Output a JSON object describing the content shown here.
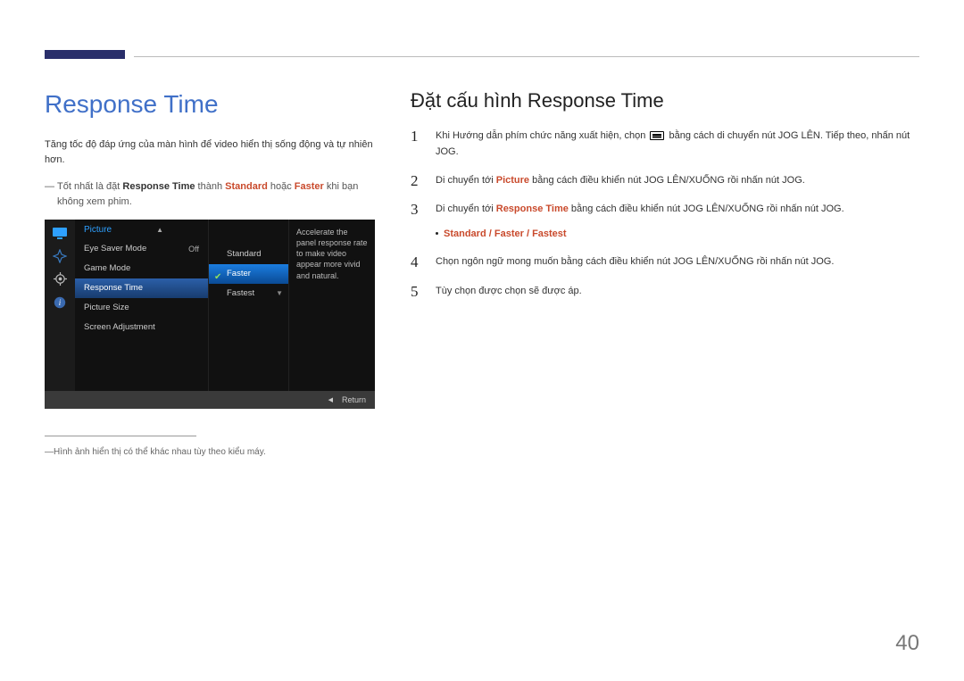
{
  "left": {
    "heading": "Response Time",
    "intro": "Tăng tốc độ đáp ứng của màn hình để video hiển thị sống động và tự nhiên hơn.",
    "note_pre": "Tốt nhất là đặt ",
    "note_rt": "Response Time",
    "note_mid": " thành ",
    "note_std": "Standard",
    "note_or": " hoặc ",
    "note_fast": "Faster",
    "note_post": " khi bạn không xem phim.",
    "footnote": "Hình ảnh hiển thị có thể khác nhau tùy theo kiểu máy."
  },
  "osd": {
    "title": "Picture",
    "col1": [
      {
        "label": "Eye Saver Mode",
        "value": "Off",
        "selected": false
      },
      {
        "label": "Game Mode",
        "value": "",
        "selected": false
      },
      {
        "label": "Response Time",
        "value": "",
        "selected": true
      },
      {
        "label": "Picture Size",
        "value": "",
        "selected": false
      },
      {
        "label": "Screen Adjustment",
        "value": "",
        "selected": false
      }
    ],
    "col2": [
      {
        "label": "Standard",
        "highlight": false,
        "checked": false
      },
      {
        "label": "Faster",
        "highlight": true,
        "checked": true
      },
      {
        "label": "Fastest",
        "highlight": false,
        "checked": false
      }
    ],
    "description": "Accelerate the panel response rate to make video appear more vivid and natural.",
    "footer": "Return"
  },
  "right": {
    "heading": "Đặt cấu hình Response Time",
    "steps": [
      {
        "n": "1",
        "segments": [
          {
            "t": "Khi Hướng dẫn phím chức năng xuất hiện, chọn "
          },
          {
            "icon": "menu"
          },
          {
            "t": " bằng cách di chuyển nút JOG LÊN. Tiếp theo, nhấn nút JOG."
          }
        ]
      },
      {
        "n": "2",
        "segments": [
          {
            "t": "Di chuyển tới "
          },
          {
            "t": "Picture",
            "hl": true
          },
          {
            "t": " bằng cách điều khiển nút JOG LÊN/XUỐNG rồi nhấn nút JOG."
          }
        ]
      },
      {
        "n": "3",
        "segments": [
          {
            "t": "Di chuyển tới "
          },
          {
            "t": "Response Time",
            "hl": true
          },
          {
            "t": " bằng cách điều khiển nút JOG LÊN/XUỐNG rồi nhấn nút JOG."
          }
        ],
        "options_line": true
      },
      {
        "n": "4",
        "segments": [
          {
            "t": "Chọn ngôn ngữ mong muốn bằng cách điều khiển nút JOG LÊN/XUỐNG rồi nhấn nút JOG."
          }
        ]
      },
      {
        "n": "5",
        "segments": [
          {
            "t": "Tùy chọn được chọn sẽ được áp."
          }
        ]
      }
    ],
    "options": {
      "a": "Standard",
      "b": "Faster",
      "c": "Fastest",
      "sep": " / "
    }
  },
  "page_number": "40"
}
